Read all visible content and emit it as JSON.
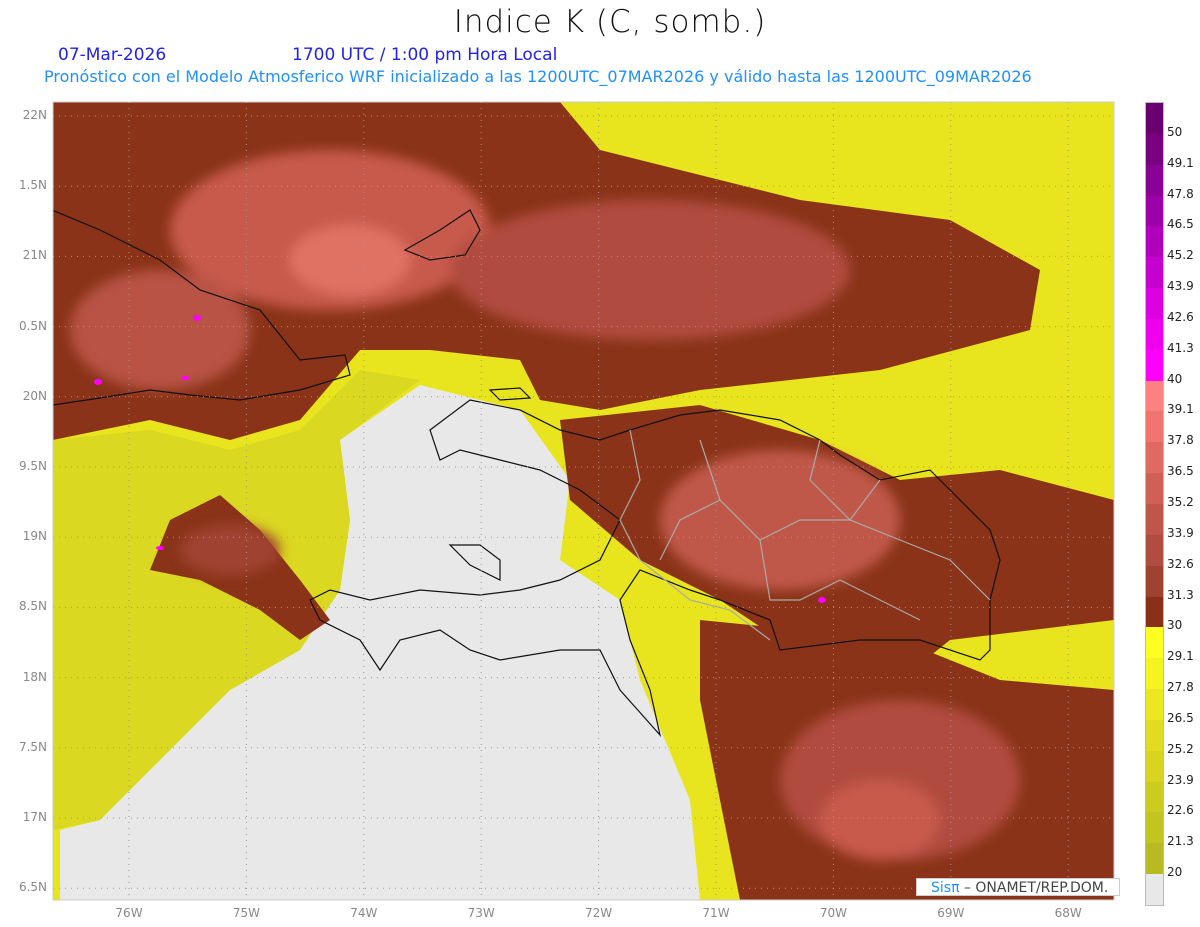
{
  "header": {
    "title": "Indice K (C, somb.)",
    "date": "07-Mar-2026",
    "time": "1700 UTC / 1:00 pm Hora Local",
    "subtitle": "Pronóstico con el Modelo Atmosferico WRF inicializado a las 1200UTC_07MAR2026 y válido hasta las  1200UTC_09MAR2026"
  },
  "map": {
    "lat_labels": [
      "22N",
      "1.5N",
      "21N",
      "0.5N",
      "20N",
      "9.5N",
      "19N",
      "8.5N",
      "18N",
      "7.5N",
      "17N",
      "6.5N"
    ],
    "lon_labels": [
      "76W",
      "75W",
      "74W",
      "73W",
      "72W",
      "71W",
      "70W",
      "69W",
      "68W"
    ],
    "grid": true
  },
  "colorbar": {
    "labels": [
      "50",
      "49.1",
      "47.8",
      "46.5",
      "45.2",
      "43.9",
      "42.6",
      "41.3",
      "40",
      "39.1",
      "37.8",
      "36.5",
      "35.2",
      "33.9",
      "32.6",
      "31.3",
      "30",
      "29.1",
      "27.8",
      "26.5",
      "25.2",
      "23.9",
      "22.6",
      "21.3",
      "20"
    ],
    "colors": [
      "#6a0070",
      "#780080",
      "#8a0094",
      "#9c00a8",
      "#b000bc",
      "#c600d0",
      "#dc00e0",
      "#ee00ee",
      "#ff00ff",
      "#ff8080",
      "#f07470",
      "#e06a62",
      "#d06056",
      "#c0564a",
      "#b04c40",
      "#a04230",
      "#8a3018",
      "#ffff22",
      "#f6f420",
      "#ece820",
      "#e2dc20",
      "#d8d420",
      "#cccc20",
      "#c2c420",
      "#b8ba22",
      "#e8e8e8"
    ]
  },
  "credit": {
    "brand": "Sisπ",
    "text": " –  ONAMET/REP.DOM."
  }
}
